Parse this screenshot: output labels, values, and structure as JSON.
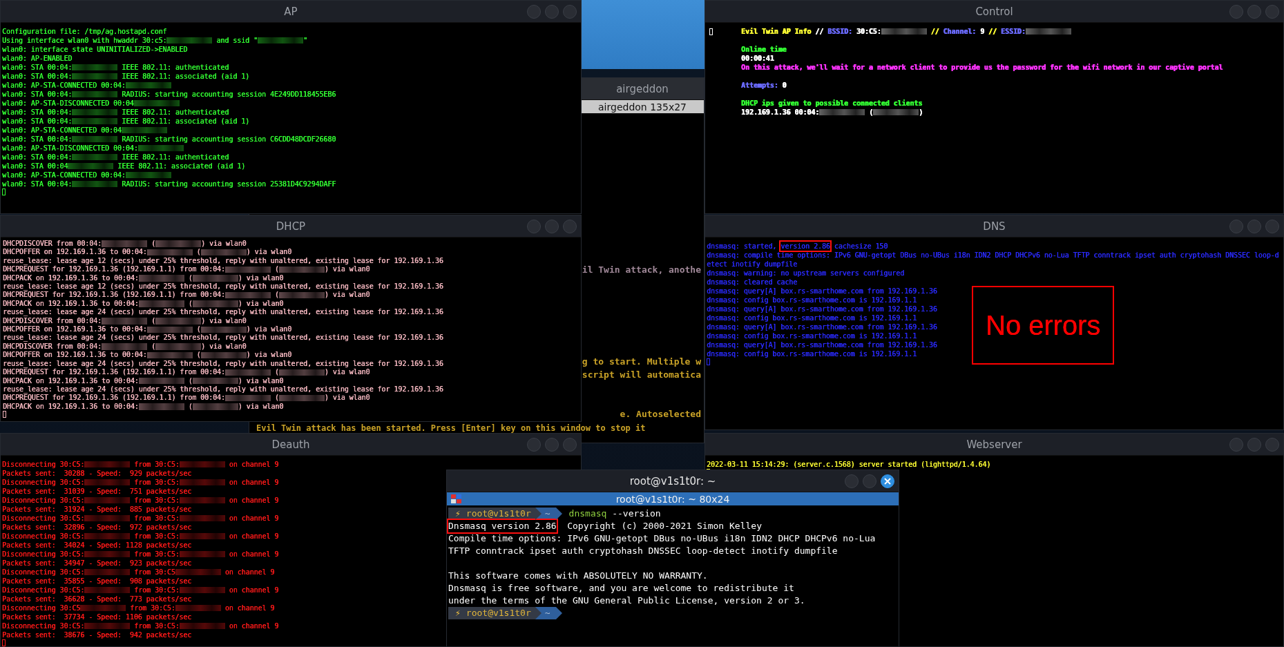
{
  "windows": [
    {
      "title": "AP",
      "kind": "log",
      "color": "#33ff33",
      "lines": [
        {
          "kind": "plain",
          "text": "Configuration file: /tmp/ag.hostapd.conf"
        },
        {
          "kind": "mixed",
          "segments": [
            {
              "kind": "text",
              "text": "Using interface wlan0 with hwaddr 30:c5:"
            },
            {
              "kind": "blur"
            },
            {
              "kind": "text",
              "text": " and ssid \""
            },
            {
              "kind": "blur"
            },
            {
              "kind": "text",
              "text": "\""
            }
          ]
        },
        {
          "kind": "plain",
          "text": "wlan0: interface state UNINITIALIZED->ENABLED"
        },
        {
          "kind": "plain",
          "text": "wlan0: AP-ENABLED"
        },
        {
          "kind": "mixed",
          "segments": [
            {
              "kind": "text",
              "text": "wlan0: STA 00:04:"
            },
            {
              "kind": "blur"
            },
            {
              "kind": "text",
              "text": " IEEE 802.11: authenticated"
            }
          ]
        },
        {
          "kind": "mixed",
          "segments": [
            {
              "kind": "text",
              "text": "wlan0: STA 00:04:"
            },
            {
              "kind": "blur"
            },
            {
              "kind": "text",
              "text": " IEEE 802.11: associated (aid 1)"
            }
          ]
        },
        {
          "kind": "mixed",
          "segments": [
            {
              "kind": "text",
              "text": "wlan0: AP-STA-CONNECTED 00:04:"
            },
            {
              "kind": "blur"
            }
          ]
        },
        {
          "kind": "mixed",
          "segments": [
            {
              "kind": "text",
              "text": "wlan0: STA 00:04:"
            },
            {
              "kind": "blur"
            },
            {
              "kind": "text",
              "text": " RADIUS: starting accounting session 4E249DD118455EB6"
            }
          ]
        },
        {
          "kind": "mixed",
          "segments": [
            {
              "kind": "text",
              "text": "wlan0: AP-STA-DISCONNECTED 00:04"
            },
            {
              "kind": "blur"
            }
          ]
        },
        {
          "kind": "mixed",
          "segments": [
            {
              "kind": "text",
              "text": "wlan0: STA 00:04:"
            },
            {
              "kind": "blur"
            },
            {
              "kind": "text",
              "text": " IEEE 802.11: authenticated"
            }
          ]
        },
        {
          "kind": "mixed",
          "segments": [
            {
              "kind": "text",
              "text": "wlan0: STA 00:04:"
            },
            {
              "kind": "blur"
            },
            {
              "kind": "text",
              "text": " IEEE 802.11: associated (aid 1)"
            }
          ]
        },
        {
          "kind": "mixed",
          "segments": [
            {
              "kind": "text",
              "text": "wlan0: AP-STA-CONNECTED 00:04"
            },
            {
              "kind": "blur"
            }
          ]
        },
        {
          "kind": "mixed",
          "segments": [
            {
              "kind": "text",
              "text": "wlan0: STA 00:04:"
            },
            {
              "kind": "blur"
            },
            {
              "kind": "text",
              "text": " RADIUS: starting accounting session C6CDD48DCDF26680"
            }
          ]
        },
        {
          "kind": "mixed",
          "segments": [
            {
              "kind": "text",
              "text": "wlan0: AP-STA-DISCONNECTED 00:04:"
            },
            {
              "kind": "blur"
            }
          ]
        },
        {
          "kind": "mixed",
          "segments": [
            {
              "kind": "text",
              "text": "wlan0: STA 00:04:"
            },
            {
              "kind": "blur"
            },
            {
              "kind": "text",
              "text": " IEEE 802.11: authenticated"
            }
          ]
        },
        {
          "kind": "mixed",
          "segments": [
            {
              "kind": "text",
              "text": "wlan0: STA 00:04"
            },
            {
              "kind": "blur"
            },
            {
              "kind": "text",
              "text": " IEEE 802.11: associated (aid 1)"
            }
          ]
        },
        {
          "kind": "mixed",
          "segments": [
            {
              "kind": "text",
              "text": "wlan0: AP-STA-CONNECTED 00:04:"
            },
            {
              "kind": "blur"
            }
          ]
        },
        {
          "kind": "mixed",
          "segments": [
            {
              "kind": "text",
              "text": "wlan0: STA 00:04:"
            },
            {
              "kind": "blur"
            },
            {
              "kind": "text",
              "text": " RADIUS: starting accounting session 25381D4C9294DAFF"
            }
          ]
        },
        {
          "kind": "cursor"
        }
      ]
    },
    {
      "title": "airgeddon",
      "kind": "background",
      "tab": "airgeddon 135x27",
      "color": "#c9a227",
      "lines": [
        {
          "kind": "blank"
        },
        {
          "kind": "blank"
        },
        {
          "kind": "blank"
        },
        {
          "kind": "blank"
        },
        {
          "kind": "blank"
        },
        {
          "kind": "blank"
        },
        {
          "kind": "blank"
        },
        {
          "kind": "blank"
        },
        {
          "kind": "blank"
        },
        {
          "kind": "blank"
        },
        {
          "kind": "blank"
        },
        {
          "kind": "cut",
          "text": "il Twin attack, anothe",
          "color": "#a08898"
        },
        {
          "kind": "blank"
        },
        {
          "kind": "blank"
        },
        {
          "kind": "blank"
        },
        {
          "kind": "blank"
        },
        {
          "kind": "blank"
        },
        {
          "kind": "blank"
        },
        {
          "kind": "cut",
          "text": "g to start. Multiple w",
          "color": "#c9a227"
        },
        {
          "kind": "cut",
          "text": "script will automatica",
          "color": "#c9a227"
        },
        {
          "kind": "blank"
        },
        {
          "kind": "blank"
        },
        {
          "kind": "cut",
          "text": "e. Autoselected",
          "color": "#c9a227"
        },
        {
          "kind": "plain",
          "text": "Evil Twin attack has been started. Press [Enter] key on this window to stop it"
        }
      ]
    },
    {
      "title": "Control",
      "kind": "log",
      "color": "#ffffff",
      "indent": true,
      "lines": [
        {
          "kind": "mixed",
          "segments": [
            {
              "kind": "cursor"
            },
            {
              "kind": "text",
              "text": "Evil Twin AP Info",
              "color": "#ffff33"
            },
            {
              "kind": "text",
              "text": " // ",
              "color": "#ffffff"
            },
            {
              "kind": "text",
              "text": "BSSID:",
              "color": "#6b6bff"
            },
            {
              "kind": "text",
              "text": " 30:C5:",
              "color": "#ffffff"
            },
            {
              "kind": "blur"
            },
            {
              "kind": "text",
              "text": " // ",
              "color": "#ffff33"
            },
            {
              "kind": "text",
              "text": "Channel:",
              "color": "#6b6bff"
            },
            {
              "kind": "text",
              "text": " 9 ",
              "color": "#ffffff"
            },
            {
              "kind": "text",
              "text": "// ",
              "color": "#ffff33"
            },
            {
              "kind": "text",
              "text": "ESSID:",
              "color": "#6b6bff"
            },
            {
              "kind": "blur"
            }
          ]
        },
        {
          "kind": "blank"
        },
        {
          "kind": "mixed",
          "segments": [
            {
              "kind": "text",
              "text": "Online time",
              "color": "#33ff33"
            }
          ]
        },
        {
          "kind": "mixed",
          "segments": [
            {
              "kind": "text",
              "text": "00:00:41",
              "color": "#ffffff"
            }
          ]
        },
        {
          "kind": "mixed",
          "segments": [
            {
              "kind": "text",
              "text": "On this attack, we'll wait for a network client to provide us the password for the wifi network in our captive portal",
              "color": "#ff33ff"
            }
          ]
        },
        {
          "kind": "blank"
        },
        {
          "kind": "mixed",
          "segments": [
            {
              "kind": "text",
              "text": "Attempts:",
              "color": "#6b6bff"
            },
            {
              "kind": "text",
              "text": " 0",
              "color": "#ffffff"
            }
          ]
        },
        {
          "kind": "blank"
        },
        {
          "kind": "mixed",
          "segments": [
            {
              "kind": "text",
              "text": "DHCP ips given to possible connected clients",
              "color": "#33ff33"
            }
          ]
        },
        {
          "kind": "mixed",
          "segments": [
            {
              "kind": "text",
              "text": "192.169.1.36 00:04:",
              "color": "#ffffff"
            },
            {
              "kind": "blur"
            },
            {
              "kind": "text",
              "text": " (",
              "color": "#ffffff"
            },
            {
              "kind": "blur"
            },
            {
              "kind": "text",
              "text": ")",
              "color": "#ffffff"
            }
          ]
        }
      ]
    },
    {
      "title": "DHCP",
      "kind": "log",
      "color": "#f5b8c0",
      "lines": [
        {
          "kind": "mixed",
          "segments": [
            {
              "kind": "text",
              "text": "DHCPDISCOVER from 00:04:"
            },
            {
              "kind": "blur"
            },
            {
              "kind": "text",
              "text": " ("
            },
            {
              "kind": "blur"
            },
            {
              "kind": "text",
              "text": ") via wlan0"
            }
          ]
        },
        {
          "kind": "mixed",
          "segments": [
            {
              "kind": "text",
              "text": "DHCPOFFER on 192.169.1.36 to 00:04:"
            },
            {
              "kind": "blur"
            },
            {
              "kind": "text",
              "text": " ("
            },
            {
              "kind": "blur"
            },
            {
              "kind": "text",
              "text": ") via wlan0"
            }
          ]
        },
        {
          "kind": "plain",
          "text": "reuse_lease: lease age 12 (secs) under 25% threshold, reply with unaltered, existing lease for 192.169.1.36"
        },
        {
          "kind": "mixed",
          "segments": [
            {
              "kind": "text",
              "text": "DHCPREQUEST for 192.169.1.36 (192.169.1.1) from 00:04:"
            },
            {
              "kind": "blur"
            },
            {
              "kind": "text",
              "text": " ("
            },
            {
              "kind": "blur"
            },
            {
              "kind": "text",
              "text": ") via wlan0"
            }
          ]
        },
        {
          "kind": "mixed",
          "segments": [
            {
              "kind": "text",
              "text": "DHCPACK on 192.169.1.36 to 00:04:"
            },
            {
              "kind": "blur"
            },
            {
              "kind": "text",
              "text": " ("
            },
            {
              "kind": "blur"
            },
            {
              "kind": "text",
              "text": ") via wlan0"
            }
          ]
        },
        {
          "kind": "plain",
          "text": "reuse_lease: lease age 12 (secs) under 25% threshold, reply with unaltered, existing lease for 192.169.1.36"
        },
        {
          "kind": "mixed",
          "segments": [
            {
              "kind": "text",
              "text": "DHCPREQUEST for 192.169.1.36 (192.169.1.1) from 00:04:"
            },
            {
              "kind": "blur"
            },
            {
              "kind": "text",
              "text": " ("
            },
            {
              "kind": "blur"
            },
            {
              "kind": "text",
              "text": ") via wlan0"
            }
          ]
        },
        {
          "kind": "mixed",
          "segments": [
            {
              "kind": "text",
              "text": "DHCPACK on 192.169.1.36 to 00:04:"
            },
            {
              "kind": "blur"
            },
            {
              "kind": "text",
              "text": " ("
            },
            {
              "kind": "blur"
            },
            {
              "kind": "text",
              "text": ") via wlan0"
            }
          ]
        },
        {
          "kind": "plain",
          "text": "reuse_lease: lease age 24 (secs) under 25% threshold, reply with unaltered, existing lease for 192.169.1.36"
        },
        {
          "kind": "mixed",
          "segments": [
            {
              "kind": "text",
              "text": "DHCPDISCOVER from 00:04:"
            },
            {
              "kind": "blur"
            },
            {
              "kind": "text",
              "text": " ("
            },
            {
              "kind": "blur"
            },
            {
              "kind": "text",
              "text": ") via wlan0"
            }
          ]
        },
        {
          "kind": "mixed",
          "segments": [
            {
              "kind": "text",
              "text": "DHCPOFFER on 192.169.1.36 to 00:04:"
            },
            {
              "kind": "blur"
            },
            {
              "kind": "text",
              "text": " ("
            },
            {
              "kind": "blur"
            },
            {
              "kind": "text",
              "text": ") via wlan0"
            }
          ]
        },
        {
          "kind": "plain",
          "text": "reuse_lease: lease age 24 (secs) under 25% threshold, reply with unaltered, existing lease for 192.169.1.36"
        },
        {
          "kind": "mixed",
          "segments": [
            {
              "kind": "text",
              "text": "DHCPDISCOVER from 00:04:"
            },
            {
              "kind": "blur"
            },
            {
              "kind": "text",
              "text": " ("
            },
            {
              "kind": "blur"
            },
            {
              "kind": "text",
              "text": ") via wlan0"
            }
          ]
        },
        {
          "kind": "mixed",
          "segments": [
            {
              "kind": "text",
              "text": "DHCPOFFER on 192.169.1.36 to 00:04:"
            },
            {
              "kind": "blur"
            },
            {
              "kind": "text",
              "text": " ("
            },
            {
              "kind": "blur"
            },
            {
              "kind": "text",
              "text": ") via wlan0"
            }
          ]
        },
        {
          "kind": "plain",
          "text": "reuse_lease: lease age 24 (secs) under 25% threshold, reply with unaltered, existing lease for 192.169.1.36"
        },
        {
          "kind": "mixed",
          "segments": [
            {
              "kind": "text",
              "text": "DHCPREQUEST for 192.169.1.36 (192.169.1.1) from 00:04:"
            },
            {
              "kind": "blur"
            },
            {
              "kind": "text",
              "text": " ("
            },
            {
              "kind": "blur"
            },
            {
              "kind": "text",
              "text": ") via wlan0"
            }
          ]
        },
        {
          "kind": "mixed",
          "segments": [
            {
              "kind": "text",
              "text": "DHCPACK on 192.169.1.36 to 00:04:"
            },
            {
              "kind": "blur"
            },
            {
              "kind": "text",
              "text": " ("
            },
            {
              "kind": "blur"
            },
            {
              "kind": "text",
              "text": ") via wlan0"
            }
          ]
        },
        {
          "kind": "plain",
          "text": "reuse_lease: lease age 24 (secs) under 25% threshold, reply with unaltered, existing lease for 192.169.1.36"
        },
        {
          "kind": "mixed",
          "segments": [
            {
              "kind": "text",
              "text": "DHCPREQUEST for 192.169.1.36 (192.169.1.1) from 00:04:"
            },
            {
              "kind": "blur"
            },
            {
              "kind": "text",
              "text": " ("
            },
            {
              "kind": "blur"
            },
            {
              "kind": "text",
              "text": ") via wlan0"
            }
          ]
        },
        {
          "kind": "mixed",
          "segments": [
            {
              "kind": "text",
              "text": "DHCPACK on 192.169.1.36 to 00:04:"
            },
            {
              "kind": "blur"
            },
            {
              "kind": "text",
              "text": " ("
            },
            {
              "kind": "blur"
            },
            {
              "kind": "text",
              "text": ") via wlan0"
            }
          ]
        },
        {
          "kind": "cursor"
        }
      ]
    },
    {
      "title": "DNS",
      "kind": "log",
      "color": "#2b2bff",
      "annotation": "No errors",
      "lines": [
        {
          "kind": "mixed",
          "segments": [
            {
              "kind": "text",
              "text": "dnsmasq: started, "
            },
            {
              "kind": "text",
              "text": "version 2.86",
              "boxed": true
            },
            {
              "kind": "text",
              "text": " cachesize 150"
            }
          ]
        },
        {
          "kind": "plain",
          "text": "dnsmasq: compile time options: IPv6 GNU-getopt DBus no-UBus i18n IDN2 DHCP DHCPv6 no-Lua TFTP conntrack ipset auth cryptohash DNSSEC loop-d"
        },
        {
          "kind": "plain",
          "text": "etect inotify dumpfile"
        },
        {
          "kind": "plain",
          "text": "dnsmasq: warning: no upstream servers configured"
        },
        {
          "kind": "plain",
          "text": "dnsmasq: cleared cache"
        },
        {
          "kind": "plain",
          "text": "dnsmasq: query[A] box.rs-smarthome.com from 192.169.1.36"
        },
        {
          "kind": "plain",
          "text": "dnsmasq: config box.rs-smarthome.com is 192.169.1.1"
        },
        {
          "kind": "plain",
          "text": "dnsmasq: query[A] box.rs-smarthome.com from 192.169.1.36"
        },
        {
          "kind": "plain",
          "text": "dnsmasq: config box.rs-smarthome.com is 192.169.1.1"
        },
        {
          "kind": "plain",
          "text": "dnsmasq: query[A] box.rs-smarthome.com from 192.169.1.36"
        },
        {
          "kind": "plain",
          "text": "dnsmasq: config box.rs-smarthome.com is 192.169.1.1"
        },
        {
          "kind": "plain",
          "text": "dnsmasq: query[A] box.rs-smarthome.com from 192.169.1.36"
        },
        {
          "kind": "plain",
          "text": "dnsmasq: config box.rs-smarthome.com is 192.169.1.1"
        },
        {
          "kind": "cursor"
        }
      ]
    },
    {
      "title": "Deauth",
      "kind": "log",
      "color": "#ff1a1a",
      "lines": [
        {
          "kind": "mixed",
          "segments": [
            {
              "kind": "text",
              "text": "Disconnecting 30:C5:"
            },
            {
              "kind": "blur"
            },
            {
              "kind": "text",
              "text": " from 30:C5:"
            },
            {
              "kind": "blur"
            },
            {
              "kind": "text",
              "text": " on channel 9"
            }
          ]
        },
        {
          "kind": "plain",
          "text": "Packets sent:  30288 - Speed:  929 packets/sec"
        },
        {
          "kind": "mixed",
          "segments": [
            {
              "kind": "text",
              "text": "Disconnecting 30:C5:"
            },
            {
              "kind": "blur"
            },
            {
              "kind": "text",
              "text": " from 30:C5:"
            },
            {
              "kind": "blur"
            },
            {
              "kind": "text",
              "text": " on channel 9"
            }
          ]
        },
        {
          "kind": "plain",
          "text": "Packets sent:  31039 - Speed:  751 packets/sec"
        },
        {
          "kind": "mixed",
          "segments": [
            {
              "kind": "text",
              "text": "Disconnecting 30:C5:"
            },
            {
              "kind": "blur"
            },
            {
              "kind": "text",
              "text": " from 30:C5:"
            },
            {
              "kind": "blur"
            },
            {
              "kind": "text",
              "text": " on channel 9"
            }
          ]
        },
        {
          "kind": "plain",
          "text": "Packets sent:  31924 - Speed:  885 packets/sec"
        },
        {
          "kind": "mixed",
          "segments": [
            {
              "kind": "text",
              "text": "Disconnecting 30:C5:"
            },
            {
              "kind": "blur"
            },
            {
              "kind": "text",
              "text": " from 30:C5:"
            },
            {
              "kind": "blur"
            },
            {
              "kind": "text",
              "text": " on channel 9"
            }
          ]
        },
        {
          "kind": "plain",
          "text": "Packets sent:  32896 - Speed:  972 packets/sec"
        },
        {
          "kind": "mixed",
          "segments": [
            {
              "kind": "text",
              "text": "Disconnecting 30:C5:"
            },
            {
              "kind": "blur"
            },
            {
              "kind": "text",
              "text": " from 30:C5:"
            },
            {
              "kind": "blur"
            },
            {
              "kind": "text",
              "text": " on channel 9"
            }
          ]
        },
        {
          "kind": "plain",
          "text": "Packets sent:  34024 - Speed: 1128 packets/sec"
        },
        {
          "kind": "mixed",
          "segments": [
            {
              "kind": "text",
              "text": "Disconnecting 30:C5:"
            },
            {
              "kind": "blur"
            },
            {
              "kind": "text",
              "text": " from 30:C5:"
            },
            {
              "kind": "blur"
            },
            {
              "kind": "text",
              "text": " on channel 9"
            }
          ]
        },
        {
          "kind": "plain",
          "text": "Packets sent:  34947 - Speed:  923 packets/sec"
        },
        {
          "kind": "mixed",
          "segments": [
            {
              "kind": "text",
              "text": "Disconnecting 30:C5:"
            },
            {
              "kind": "blur"
            },
            {
              "kind": "text",
              "text": " from 30:C5"
            },
            {
              "kind": "blur"
            },
            {
              "kind": "text",
              "text": " on channel 9"
            }
          ]
        },
        {
          "kind": "plain",
          "text": "Packets sent:  35855 - Speed:  908 packets/sec"
        },
        {
          "kind": "mixed",
          "segments": [
            {
              "kind": "text",
              "text": "Disconnecting 30:C5:"
            },
            {
              "kind": "blur"
            },
            {
              "kind": "text",
              "text": " from 30:C5:"
            },
            {
              "kind": "blur"
            },
            {
              "kind": "text",
              "text": " on channel 9"
            }
          ]
        },
        {
          "kind": "plain",
          "text": "Packets sent:  36628 - Speed:  773 packets/sec"
        },
        {
          "kind": "mixed",
          "segments": [
            {
              "kind": "text",
              "text": "Disconnecting 30:C5"
            },
            {
              "kind": "blur"
            },
            {
              "kind": "text",
              "text": " from 30:C5:"
            },
            {
              "kind": "blur"
            },
            {
              "kind": "text",
              "text": " on channel 9"
            }
          ]
        },
        {
          "kind": "plain",
          "text": "Packets sent:  37734 - Speed: 1106 packets/sec"
        },
        {
          "kind": "mixed",
          "segments": [
            {
              "kind": "text",
              "text": "Disconnecting 30:C5:"
            },
            {
              "kind": "blur"
            },
            {
              "kind": "text",
              "text": " from 30:C5:"
            },
            {
              "kind": "blur"
            },
            {
              "kind": "text",
              "text": " on channel 9"
            }
          ]
        },
        {
          "kind": "plain",
          "text": "Packets sent:  38676 - Speed:  942 packets/sec"
        },
        {
          "kind": "cursor"
        }
      ]
    },
    {
      "title": "Webserver",
      "kind": "log",
      "color": "#ffff33",
      "lines": [
        {
          "kind": "plain",
          "text": "2022-03-11 15:14:29: (server.c.1568) server started (lighttpd/1.4.64)"
        },
        {
          "kind": "cursor"
        }
      ]
    },
    {
      "title": "root@v1s1t0r: ~",
      "kind": "terminal",
      "tab": "root@v1s1t0r: ~ 80x24",
      "active": true,
      "color": "#ffffff",
      "lines": [
        {
          "kind": "prompt",
          "icon": "⚡",
          "user": "root@v1s1t0r",
          "dir": "~",
          "command": "dnsmasq",
          "args": "--version"
        },
        {
          "kind": "mixed",
          "segments": [
            {
              "kind": "text",
              "text": "Dnsmasq version 2.86",
              "boxed": true
            },
            {
              "kind": "text",
              "text": "  Copyright (c) 2000-2021 Simon Kelley"
            }
          ]
        },
        {
          "kind": "plain",
          "text": "Compile time options: IPv6 GNU-getopt DBus no-UBus i18n IDN2 DHCP DHCPv6 no-Lua"
        },
        {
          "kind": "plain",
          "text": "TFTP conntrack ipset auth cryptohash DNSSEC loop-detect inotify dumpfile"
        },
        {
          "kind": "blank"
        },
        {
          "kind": "plain",
          "text": "This software comes with ABSOLUTELY NO WARRANTY."
        },
        {
          "kind": "plain",
          "text": "Dnsmasq is free software, and you are welcome to redistribute it"
        },
        {
          "kind": "plain",
          "text": "under the terms of the GNU General Public License, version 2 or 3."
        },
        {
          "kind": "prompt",
          "icon": "⚡",
          "user": "root@v1s1t0r",
          "dir": "~"
        }
      ]
    }
  ]
}
